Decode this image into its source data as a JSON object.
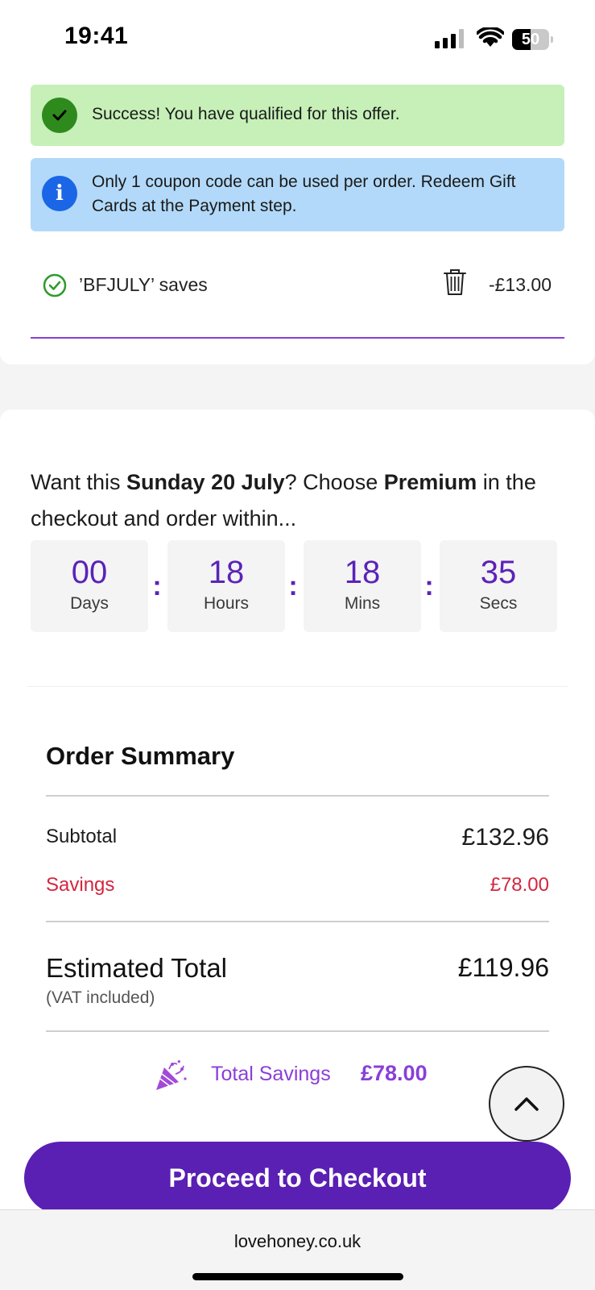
{
  "status_bar": {
    "time": "19:41",
    "battery": "50",
    "battery_level": 0.5
  },
  "alerts": {
    "success": "Success! You have qualified for this offer.",
    "info": "Only 1 coupon code can be used per order. Redeem Gift Cards at the Payment step."
  },
  "coupon": {
    "text": "’BFJULY’ saves",
    "amount": "-£13.00"
  },
  "delivery": {
    "prefix": "Want this ",
    "date": "Sunday 20 July",
    "middle": "? Choose ",
    "option": "Premium",
    "suffix": " in the checkout and order within..."
  },
  "countdown": [
    {
      "value": "00",
      "label": "Days"
    },
    {
      "value": "18",
      "label": "Hours"
    },
    {
      "value": "18",
      "label": "Mins"
    },
    {
      "value": "35",
      "label": "Secs"
    }
  ],
  "countdown_separator": ":",
  "summary": {
    "title": "Order Summary",
    "subtotal_label": "Subtotal",
    "subtotal_value": "£132.96",
    "savings_label": "Savings",
    "savings_value": "£78.00",
    "total_label": "Estimated Total",
    "vat_note": "(VAT included)",
    "total_value": "£119.96",
    "total_savings_label": "Total Savings",
    "total_savings_value": "£78.00"
  },
  "checkout_button": "Proceed to Checkout",
  "browser": {
    "url": "lovehoney.co.uk"
  },
  "icons": {
    "success": "check-circle-icon",
    "info": "info-icon",
    "coupon": "check-outline-icon",
    "delete": "trash-icon",
    "celebration": "party-popper-icon",
    "scroll": "chevron-up-icon"
  },
  "colors": {
    "brand_purple": "#5a1fb3",
    "accent_purple": "#8a3fd8",
    "savings_red": "#d3263f",
    "success_bg": "#c6f0b8",
    "info_bg": "#b2d9f9"
  }
}
